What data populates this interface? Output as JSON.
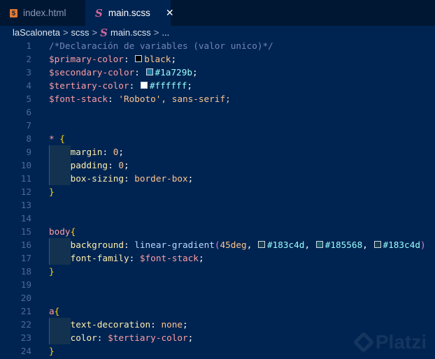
{
  "tabs": [
    {
      "label": "index.html",
      "icon": "html5-icon",
      "active": false
    },
    {
      "label": "main.scss",
      "icon": "sass-icon",
      "active": true,
      "close": "✕"
    }
  ],
  "breadcrumb": {
    "items": [
      "laScaloneta",
      "scss",
      "main.scss",
      "..."
    ],
    "sep": ">"
  },
  "watermark": "Platzi",
  "lines": [
    [
      [
        "/*Declaración de variables (valor unico)*/",
        "comment"
      ]
    ],
    [
      [
        "$primary-color",
        "var"
      ],
      [
        ": ",
        "punct"
      ],
      [
        "#000000",
        "swatch"
      ],
      [
        "black",
        "val"
      ],
      [
        ";",
        "punct"
      ]
    ],
    [
      [
        "$secondary-color",
        "var"
      ],
      [
        ": ",
        "punct"
      ],
      [
        "#1a729b",
        "swatch"
      ],
      [
        "#1a729b",
        "hex"
      ],
      [
        ";",
        "punct"
      ]
    ],
    [
      [
        "$tertiary-color",
        "var"
      ],
      [
        ": ",
        "punct"
      ],
      [
        "#ffffff",
        "swatch"
      ],
      [
        "#ffffff",
        "hex"
      ],
      [
        ";",
        "punct"
      ]
    ],
    [
      [
        "$font-stack",
        "var"
      ],
      [
        ": ",
        "punct"
      ],
      [
        "'Roboto'",
        "val"
      ],
      [
        ", sans-serif;",
        "val"
      ]
    ],
    [],
    [],
    [
      [
        "*",
        "sel"
      ],
      [
        " ",
        "punct"
      ],
      [
        "{",
        "brace"
      ]
    ],
    [
      [
        "",
        "indent"
      ],
      [
        "margin",
        "prop"
      ],
      [
        ": ",
        "punct"
      ],
      [
        "0",
        "val"
      ],
      [
        ";",
        "punct"
      ]
    ],
    [
      [
        "",
        "indent"
      ],
      [
        "padding",
        "prop"
      ],
      [
        ": ",
        "punct"
      ],
      [
        "0",
        "val"
      ],
      [
        ";",
        "punct"
      ]
    ],
    [
      [
        "",
        "indent"
      ],
      [
        "box-sizing",
        "prop"
      ],
      [
        ": ",
        "punct"
      ],
      [
        "border-box",
        "val"
      ],
      [
        ";",
        "punct"
      ]
    ],
    [
      [
        "}",
        "brace"
      ]
    ],
    [],
    [],
    [
      [
        "body",
        "sel"
      ],
      [
        "{",
        "brace"
      ]
    ],
    [
      [
        "",
        "indent"
      ],
      [
        "background",
        "prop"
      ],
      [
        ": ",
        "punct"
      ],
      [
        "linear-gradient",
        "fn"
      ],
      [
        "(",
        "paren"
      ],
      [
        "45deg",
        "val"
      ],
      [
        ", ",
        "punct"
      ],
      [
        "#183c4d",
        "swatch"
      ],
      [
        "#183c4d",
        "hex"
      ],
      [
        ", ",
        "punct"
      ],
      [
        "#185568",
        "swatch"
      ],
      [
        "#185568",
        "hex"
      ],
      [
        ", ",
        "punct"
      ],
      [
        "#183c4d",
        "swatch"
      ],
      [
        "#183c4d",
        "hex"
      ],
      [
        ")",
        "paren"
      ]
    ],
    [
      [
        "",
        "indent"
      ],
      [
        "font-family",
        "prop"
      ],
      [
        ": ",
        "punct"
      ],
      [
        "$font-stack",
        "var"
      ],
      [
        ";",
        "punct"
      ]
    ],
    [
      [
        "}",
        "brace"
      ]
    ],
    [],
    [],
    [
      [
        "a",
        "sel"
      ],
      [
        "{",
        "brace"
      ]
    ],
    [
      [
        "",
        "indent"
      ],
      [
        "text-decoration",
        "prop"
      ],
      [
        ": ",
        "punct"
      ],
      [
        "none",
        "val"
      ],
      [
        ";",
        "punct"
      ]
    ],
    [
      [
        "",
        "indent"
      ],
      [
        "color",
        "prop"
      ],
      [
        ": ",
        "punct"
      ],
      [
        "$tertiary-color",
        "var"
      ],
      [
        ";",
        "punct"
      ]
    ],
    [
      [
        "}",
        "brace"
      ]
    ]
  ]
}
